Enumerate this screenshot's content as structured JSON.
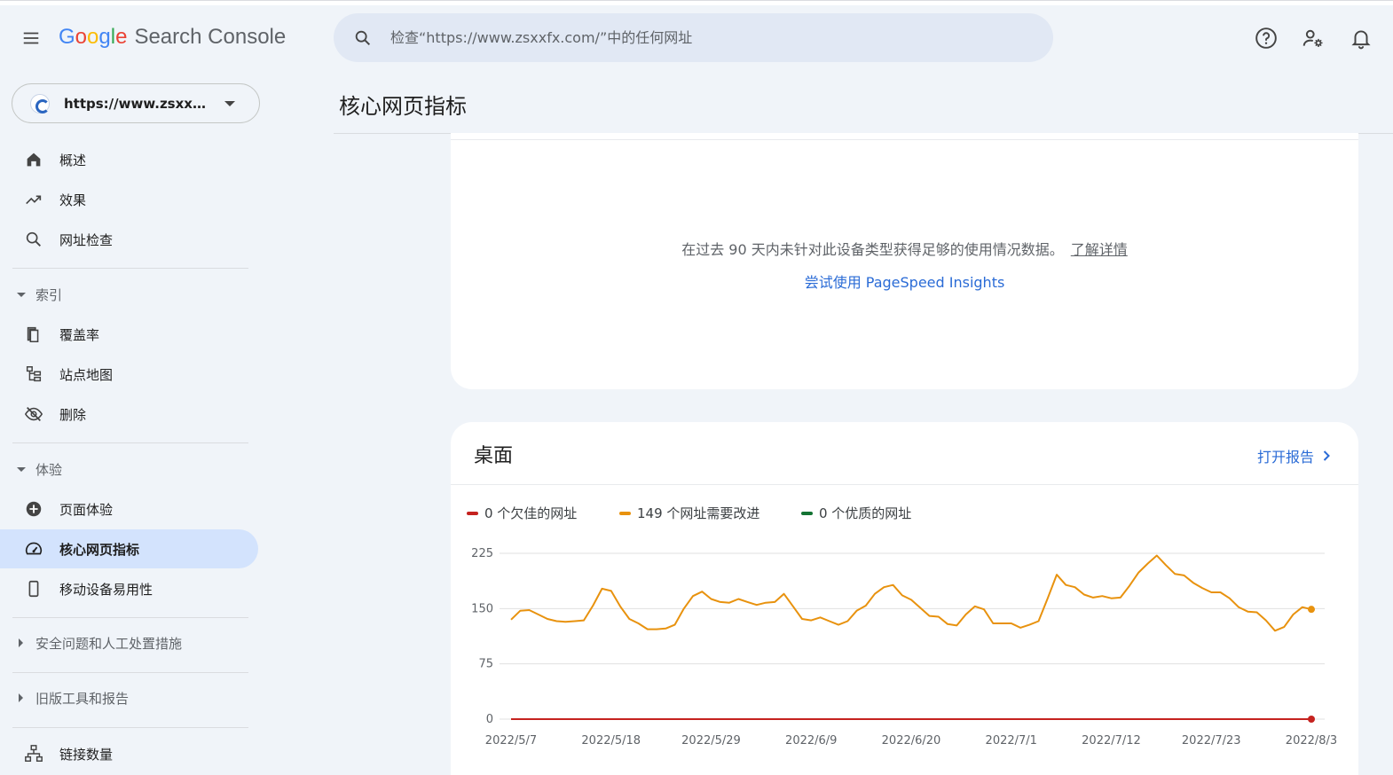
{
  "app": {
    "logo_letters": [
      "G",
      "o",
      "o",
      "g",
      "l",
      "e"
    ],
    "product": "Search Console"
  },
  "search": {
    "placeholder": "检查“https://www.zsxxfx.com/”中的任何网址"
  },
  "topbar_icons": [
    "help-icon",
    "manage-users-icon",
    "notifications-icon"
  ],
  "property": {
    "url": "https://www.zsxxfx...."
  },
  "page": {
    "title": "核心网页指标"
  },
  "sidebar": {
    "items_top": [
      {
        "label": "概述",
        "icon": "home-icon"
      },
      {
        "label": "效果",
        "icon": "trending-up-icon"
      },
      {
        "label": "网址检查",
        "icon": "search-icon"
      }
    ],
    "index_section": "索引",
    "items_index": [
      {
        "label": "覆盖率",
        "icon": "copy-icon"
      },
      {
        "label": "站点地图",
        "icon": "sitemap-icon"
      },
      {
        "label": "删除",
        "icon": "visibility-off-icon"
      }
    ],
    "experience_section": "体验",
    "items_experience": [
      {
        "label": "页面体验",
        "icon": "add-circle-icon"
      },
      {
        "label": "核心网页指标",
        "icon": "speed-icon",
        "active": true
      },
      {
        "label": "移动设备易用性",
        "icon": "smartphone-icon"
      }
    ],
    "security_section": "安全问题和人工处置措施",
    "legacy_section": "旧版工具和报告",
    "links": {
      "label": "链接数量",
      "icon": "links-icon"
    }
  },
  "mobile_card": {
    "message": "在过去 90 天内未针对此设备类型获得足够的使用情况数据。",
    "learn_more": "了解详情",
    "psi_link": "尝试使用 PageSpeed Insights"
  },
  "desktop_card": {
    "title": "桌面",
    "open_report": "打开报告"
  },
  "colors": {
    "poor": "#c5221f",
    "needs_improvement": "#e8920e",
    "good": "#137333",
    "accent": "#2a6bd6"
  },
  "chart_data": {
    "type": "line",
    "legend": [
      {
        "label": "0 个欠佳的网址",
        "color": "#c5221f"
      },
      {
        "label": "149 个网址需要改进",
        "color": "#e8920e"
      },
      {
        "label": "0 个优质的网址",
        "color": "#137333"
      }
    ],
    "yticks": [
      "225",
      "150",
      "75",
      "0"
    ],
    "ylim": [
      0,
      225
    ],
    "xtick_labels": [
      "2022/5/7",
      "2022/5/18",
      "2022/5/29",
      "2022/6/9",
      "2022/6/20",
      "2022/7/1",
      "2022/7/12",
      "2022/7/23",
      "2022/8/3"
    ],
    "x_dates": [
      "2022/5/7",
      "2022/5/8",
      "2022/5/9",
      "2022/5/10",
      "2022/5/11",
      "2022/5/12",
      "2022/5/13",
      "2022/5/14",
      "2022/5/15",
      "2022/5/16",
      "2022/5/17",
      "2022/5/18",
      "2022/5/19",
      "2022/5/20",
      "2022/5/21",
      "2022/5/22",
      "2022/5/23",
      "2022/5/24",
      "2022/5/25",
      "2022/5/26",
      "2022/5/27",
      "2022/5/28",
      "2022/5/29",
      "2022/5/30",
      "2022/5/31",
      "2022/6/1",
      "2022/6/2",
      "2022/6/3",
      "2022/6/4",
      "2022/6/5",
      "2022/6/6",
      "2022/6/7",
      "2022/6/8",
      "2022/6/9",
      "2022/6/10",
      "2022/6/11",
      "2022/6/12",
      "2022/6/13",
      "2022/6/14",
      "2022/6/15",
      "2022/6/16",
      "2022/6/17",
      "2022/6/18",
      "2022/6/19",
      "2022/6/20",
      "2022/6/21",
      "2022/6/22",
      "2022/6/23",
      "2022/6/24",
      "2022/6/25",
      "2022/6/26",
      "2022/6/27",
      "2022/6/28",
      "2022/6/29",
      "2022/6/30",
      "2022/7/1",
      "2022/7/2",
      "2022/7/3",
      "2022/7/4",
      "2022/7/5",
      "2022/7/6",
      "2022/7/7",
      "2022/7/8",
      "2022/7/9",
      "2022/7/10",
      "2022/7/11",
      "2022/7/12",
      "2022/7/13",
      "2022/7/14",
      "2022/7/15",
      "2022/7/16",
      "2022/7/17",
      "2022/7/18",
      "2022/7/19",
      "2022/7/20",
      "2022/7/21",
      "2022/7/22",
      "2022/7/23",
      "2022/7/24",
      "2022/7/25",
      "2022/7/26",
      "2022/7/27",
      "2022/7/28",
      "2022/7/29",
      "2022/7/30",
      "2022/7/31",
      "2022/8/1",
      "2022/8/2",
      "2022/8/3"
    ],
    "series": [
      {
        "name": "需要改进",
        "color": "#e8920e",
        "values": [
          135,
          147,
          148,
          142,
          136,
          133,
          132,
          133,
          134,
          154,
          177,
          174,
          153,
          136,
          130,
          122,
          122,
          123,
          128,
          150,
          167,
          173,
          163,
          159,
          158,
          163,
          159,
          155,
          158,
          159,
          170,
          153,
          136,
          134,
          138,
          133,
          128,
          133,
          147,
          154,
          170,
          179,
          182,
          168,
          162,
          151,
          140,
          139,
          129,
          127,
          142,
          153,
          149,
          130,
          130,
          130,
          124,
          128,
          133,
          164,
          196,
          182,
          179,
          169,
          165,
          167,
          164,
          165,
          181,
          199,
          211,
          222,
          209,
          197,
          195,
          185,
          178,
          172,
          172,
          164,
          152,
          146,
          145,
          134,
          120,
          125,
          142,
          152,
          149
        ]
      },
      {
        "name": "欠佳",
        "color": "#c5221f",
        "values": [
          0,
          0,
          0,
          0,
          0,
          0,
          0,
          0,
          0,
          0,
          0,
          0,
          0,
          0,
          0,
          0,
          0,
          0,
          0,
          0,
          0,
          0,
          0,
          0,
          0,
          0,
          0,
          0,
          0,
          0,
          0,
          0,
          0,
          0,
          0,
          0,
          0,
          0,
          0,
          0,
          0,
          0,
          0,
          0,
          0,
          0,
          0,
          0,
          0,
          0,
          0,
          0,
          0,
          0,
          0,
          0,
          0,
          0,
          0,
          0,
          0,
          0,
          0,
          0,
          0,
          0,
          0,
          0,
          0,
          0,
          0,
          0,
          0,
          0,
          0,
          0,
          0,
          0,
          0,
          0,
          0,
          0,
          0,
          0,
          0,
          0,
          0,
          0,
          0
        ]
      }
    ]
  }
}
